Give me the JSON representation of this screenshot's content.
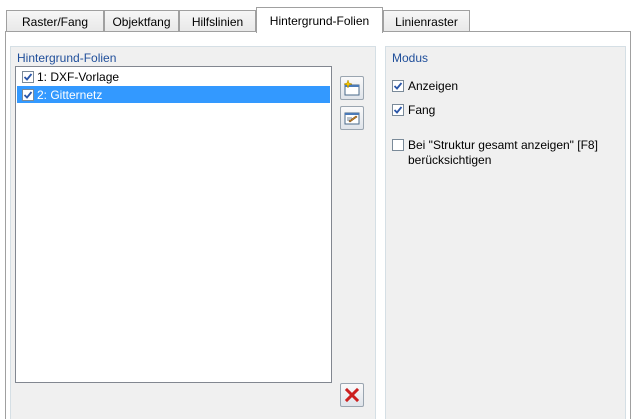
{
  "tabs": [
    {
      "label": "Raster/Fang"
    },
    {
      "label": "Objektfang"
    },
    {
      "label": "Hilfslinien"
    },
    {
      "label": "Hintergrund-Folien"
    },
    {
      "label": "Linienraster"
    }
  ],
  "active_tab": "Hintergrund-Folien",
  "layers": {
    "title": "Hintergrund-Folien",
    "items": [
      {
        "label": "1: DXF-Vorlage",
        "checked": true,
        "selected": false
      },
      {
        "label": "2: Gitternetz",
        "checked": true,
        "selected": true
      }
    ],
    "buttons": {
      "new_icon": "new-layer-icon",
      "edit_icon": "edit-layer-icon",
      "delete_icon": "delete-icon"
    }
  },
  "mode": {
    "title": "Modus",
    "show_label": "Anzeigen",
    "show_checked": true,
    "snap_label": "Fang",
    "snap_checked": true,
    "consider_line1": "Bei \"Struktur gesamt anzeigen\" [F8]",
    "consider_line2": "berücksichtigen",
    "consider_checked": false
  },
  "colors": {
    "group_title": "#1f4e9a",
    "selection": "#3399ff",
    "check": "#2b56a8",
    "delete": "#cc1f1f"
  }
}
